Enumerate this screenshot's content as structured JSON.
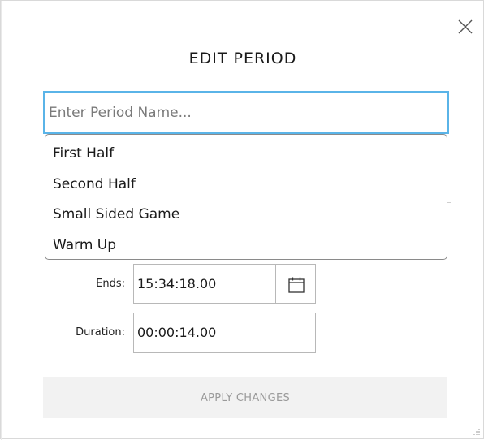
{
  "dialog": {
    "title": "EDIT PERIOD",
    "close_icon": "close-icon"
  },
  "name_input": {
    "placeholder": "Enter Period Name...",
    "value": ""
  },
  "suggestions": [
    {
      "label": "First Half"
    },
    {
      "label": "Second Half"
    },
    {
      "label": "Small Sided Game"
    },
    {
      "label": "Warm Up"
    }
  ],
  "ends": {
    "label": "Ends:",
    "value": "15:34:18.00",
    "icon": "calendar-icon"
  },
  "duration": {
    "label": "Duration:",
    "value": "00:00:14.00"
  },
  "apply_button": {
    "label": "APPLY CHANGES"
  },
  "colors": {
    "input_focus_border": "#5ab4e8",
    "disabled_button_bg": "#f2f2f2",
    "disabled_button_text": "#9a9a9a"
  }
}
